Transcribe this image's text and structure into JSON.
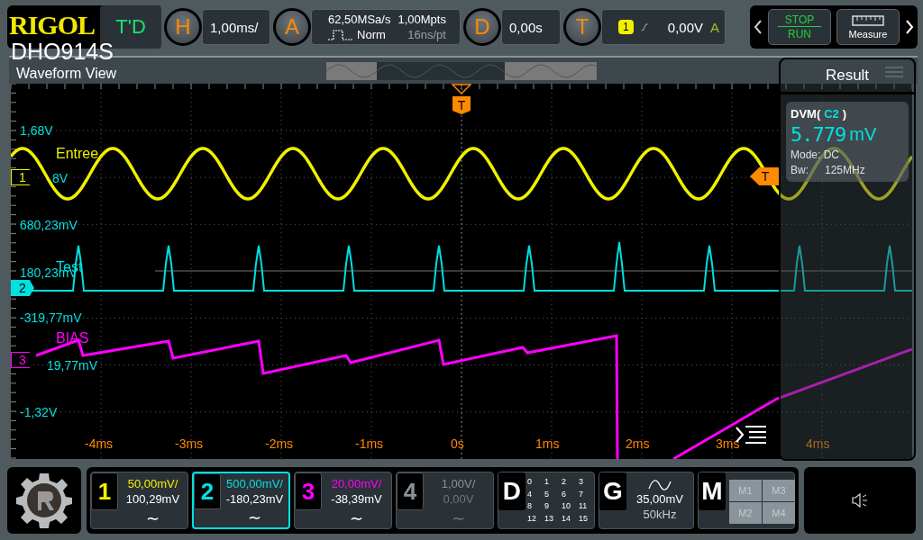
{
  "brand": {
    "logo": "RIGOL",
    "model": "DHO914S"
  },
  "top_bar": {
    "td_button": "T'D",
    "horizontal": {
      "key": "H",
      "value": "1,00ms/"
    },
    "acquire": {
      "key": "A",
      "sample_rate": "62,50MSa/s",
      "mode": "Norm",
      "memory": "1,00Mpts",
      "resolution": "16ns/pt"
    },
    "delay": {
      "key": "D",
      "value": "0,00s"
    },
    "trigger": {
      "key": "T",
      "source": "1",
      "level": "0,00V",
      "sweep": "A"
    },
    "run_stop": {
      "stop": "STOP",
      "run": "RUN"
    },
    "measure_button": "Measure"
  },
  "waveform_view": {
    "title": "Waveform View",
    "trigger_markers": [
      "T",
      "T"
    ],
    "voltage_labels": [
      "1,68V",
      "8V",
      "680,23mV",
      "180,23mV",
      "-319,77mV",
      "19,77mV",
      "-1,32V"
    ],
    "time_labels": [
      "-4ms",
      "-3ms",
      "-2ms",
      "-1ms",
      "0s",
      "1ms",
      "2ms",
      "3ms",
      "4ms"
    ],
    "trace_labels": [
      {
        "text": "Entree",
        "color": "#f0f000"
      },
      {
        "text": "Test",
        "color": "#00e0e0"
      },
      {
        "text": "BIAS",
        "color": "#ff00ff"
      }
    ],
    "channel_markers": [
      {
        "label": "1",
        "color": "#f0f000",
        "selected": false
      },
      {
        "label": "2",
        "color": "#00e0e0",
        "selected": true
      },
      {
        "label": "3",
        "color": "#ff00ff",
        "selected": false
      }
    ]
  },
  "result_panel": {
    "title": "Result",
    "dvm_prefix": "DVM(",
    "dvm_source": "C2",
    "dvm_suffix": ")",
    "value": "5.779",
    "unit": "mV",
    "mode": "Mode: DC",
    "bw_label": "Bw:",
    "bw_value": "125MHz"
  },
  "channels": [
    {
      "number": "1",
      "scale": "50,00mV/",
      "offset": "100,29mV",
      "coupling": "∼",
      "color": "#f0f000",
      "selected": false,
      "enabled": true
    },
    {
      "number": "2",
      "scale": "500,00mV/",
      "offset": "-180,23mV",
      "coupling": "∼",
      "color": "#00e0e0",
      "selected": true,
      "enabled": true
    },
    {
      "number": "3",
      "scale": "20,00mV/",
      "offset": "-38,39mV",
      "coupling": "∼",
      "color": "#ff00ff",
      "selected": false,
      "enabled": true
    },
    {
      "number": "4",
      "scale": "1,00V/",
      "offset": "0,00V",
      "coupling": "∼",
      "color": "#8a9196",
      "selected": false,
      "enabled": false
    }
  ],
  "digital": {
    "key": "D",
    "bits": [
      "0",
      "1",
      "2",
      "3",
      "4",
      "5",
      "6",
      "7",
      "8",
      "9",
      "10",
      "11",
      "12",
      "13",
      "14",
      "15"
    ]
  },
  "generator": {
    "key": "G",
    "amplitude": "35,00mV",
    "frequency": "50kHz"
  },
  "math": {
    "key": "M",
    "buttons": [
      "M1",
      "M3",
      "M2",
      "M4"
    ]
  }
}
